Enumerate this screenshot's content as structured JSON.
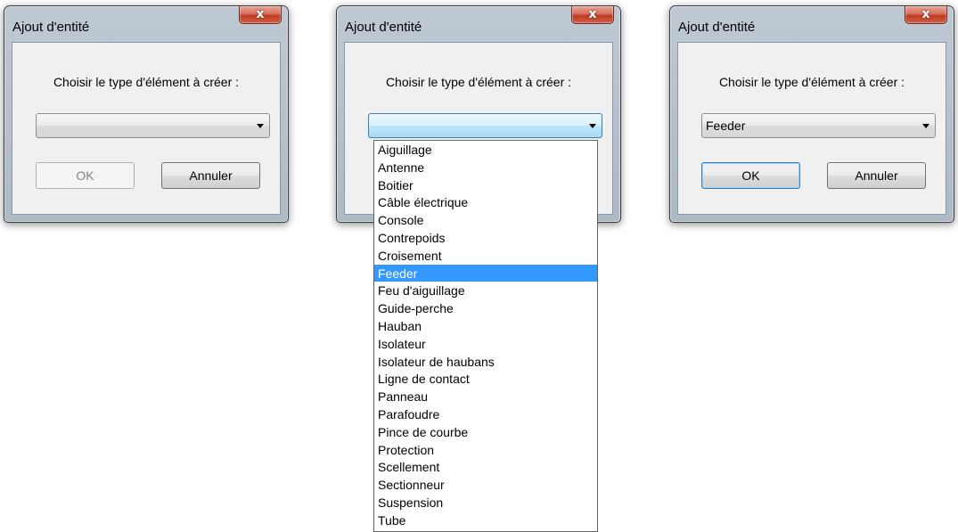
{
  "dialogs": [
    {
      "title": "Ajout d'entité",
      "close_glyph": "x",
      "prompt": "Choisir le type d'élément à créer :",
      "combo_value": "",
      "ok_label": "OK",
      "cancel_label": "Annuler",
      "ok_enabled": false,
      "dropdown_open": false
    },
    {
      "title": "Ajout d'entité",
      "close_glyph": "x",
      "prompt": "Choisir le type d'élément à créer :",
      "combo_value": "",
      "ok_label": "OK",
      "cancel_label": "Annuler",
      "dropdown_open": true
    },
    {
      "title": "Ajout d'entité",
      "close_glyph": "x",
      "prompt": "Choisir le type d'élément à créer :",
      "combo_value": "Feeder",
      "ok_label": "OK",
      "cancel_label": "Annuler",
      "ok_enabled": true,
      "dropdown_open": false
    }
  ],
  "dropdown": {
    "highlighted": "Feeder",
    "items": [
      "Aiguillage",
      "Antenne",
      "Boitier",
      "Câble électrique",
      "Console",
      "Contrepoids",
      "Croisement",
      "Feeder",
      "Feu d'aiguillage",
      "Guide-perche",
      "Hauban",
      "Isolateur",
      "Isolateur de haubans",
      "Ligne de contact",
      "Panneau",
      "Parafoudre",
      "Pince de courbe",
      "Protection",
      "Scellement",
      "Sectionneur",
      "Suspension",
      "Tube"
    ]
  },
  "colors": {
    "selection": "#3399ff",
    "close_button": "#c7402a",
    "window_frame": "#b4bfcc"
  },
  "icons": {
    "close": "close-icon",
    "combo_arrow": "chevron-down-icon"
  }
}
